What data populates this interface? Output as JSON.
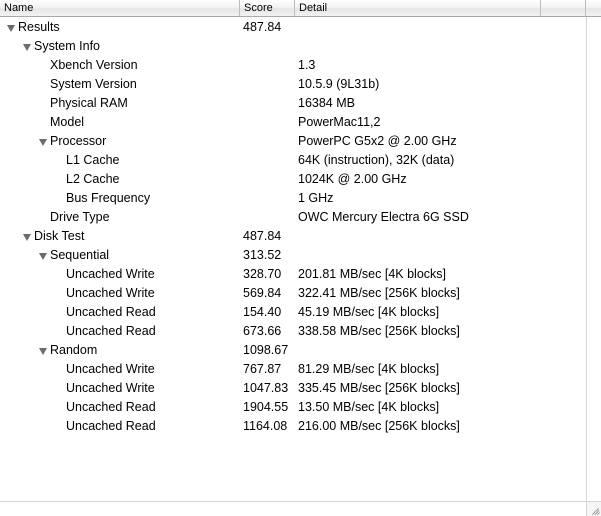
{
  "columns": {
    "name": "Name",
    "score": "Score",
    "detail": "Detail"
  },
  "rows": [
    {
      "level": 0,
      "disclosure": "expanded",
      "name": "Results",
      "score": "487.84",
      "detail": ""
    },
    {
      "level": 1,
      "disclosure": "expanded",
      "name": "System Info",
      "score": "",
      "detail": ""
    },
    {
      "level": 2,
      "disclosure": "none",
      "name": "Xbench Version",
      "score": "",
      "detail": "1.3"
    },
    {
      "level": 2,
      "disclosure": "none",
      "name": "System Version",
      "score": "",
      "detail": "10.5.9 (9L31b)"
    },
    {
      "level": 2,
      "disclosure": "none",
      "name": "Physical RAM",
      "score": "",
      "detail": "16384 MB"
    },
    {
      "level": 2,
      "disclosure": "none",
      "name": "Model",
      "score": "",
      "detail": "PowerMac11,2"
    },
    {
      "level": 2,
      "disclosure": "expanded",
      "name": "Processor",
      "score": "",
      "detail": "PowerPC G5x2 @ 2.00 GHz"
    },
    {
      "level": 3,
      "disclosure": "none",
      "name": "L1 Cache",
      "score": "",
      "detail": "64K (instruction), 32K (data)"
    },
    {
      "level": 3,
      "disclosure": "none",
      "name": "L2 Cache",
      "score": "",
      "detail": "1024K @ 2.00 GHz"
    },
    {
      "level": 3,
      "disclosure": "none",
      "name": "Bus Frequency",
      "score": "",
      "detail": "1 GHz"
    },
    {
      "level": 2,
      "disclosure": "none",
      "name": "Drive Type",
      "score": "",
      "detail": "OWC Mercury Electra 6G SSD"
    },
    {
      "level": 1,
      "disclosure": "expanded",
      "name": "Disk Test",
      "score": "487.84",
      "detail": ""
    },
    {
      "level": 2,
      "disclosure": "expanded",
      "name": "Sequential",
      "score": "313.52",
      "detail": ""
    },
    {
      "level": 3,
      "disclosure": "none",
      "name": "Uncached Write",
      "score": "328.70",
      "detail": "201.81 MB/sec [4K blocks]"
    },
    {
      "level": 3,
      "disclosure": "none",
      "name": "Uncached Write",
      "score": "569.84",
      "detail": "322.41 MB/sec [256K blocks]"
    },
    {
      "level": 3,
      "disclosure": "none",
      "name": "Uncached Read",
      "score": "154.40",
      "detail": "45.19 MB/sec [4K blocks]"
    },
    {
      "level": 3,
      "disclosure": "none",
      "name": "Uncached Read",
      "score": "673.66",
      "detail": "338.58 MB/sec [256K blocks]"
    },
    {
      "level": 2,
      "disclosure": "expanded",
      "name": "Random",
      "score": "1098.67",
      "detail": ""
    },
    {
      "level": 3,
      "disclosure": "none",
      "name": "Uncached Write",
      "score": "767.87",
      "detail": "81.29 MB/sec [4K blocks]"
    },
    {
      "level": 3,
      "disclosure": "none",
      "name": "Uncached Write",
      "score": "1047.83",
      "detail": "335.45 MB/sec [256K blocks]"
    },
    {
      "level": 3,
      "disclosure": "none",
      "name": "Uncached Read",
      "score": "1904.55",
      "detail": "13.50 MB/sec [4K blocks]"
    },
    {
      "level": 3,
      "disclosure": "none",
      "name": "Uncached Read",
      "score": "1164.08",
      "detail": "216.00 MB/sec [256K blocks]"
    }
  ]
}
